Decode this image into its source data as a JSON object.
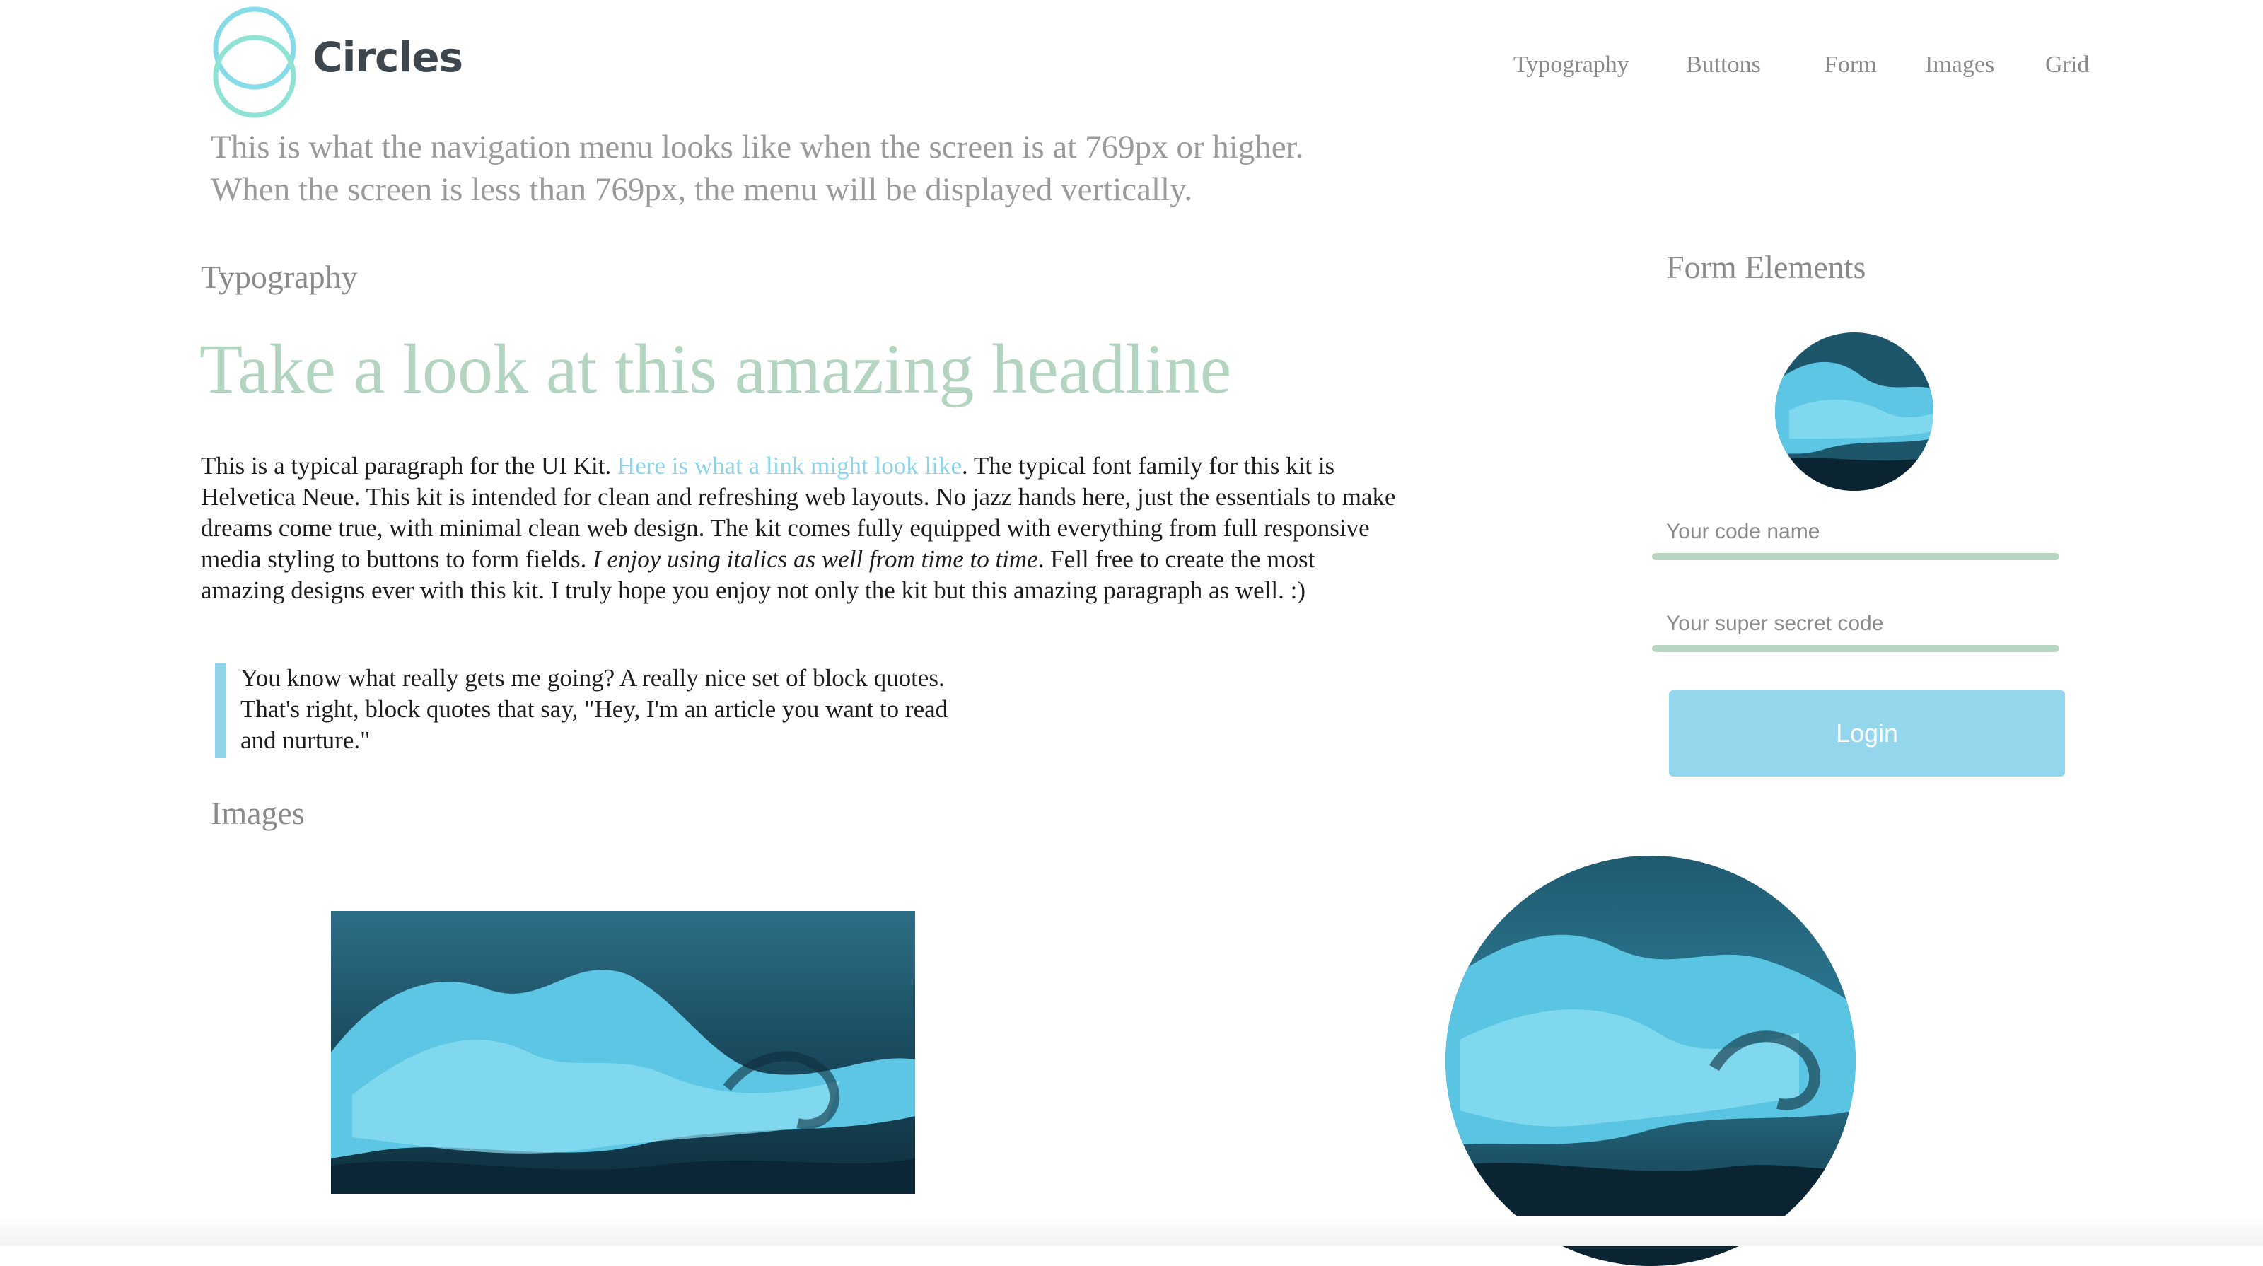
{
  "brand": {
    "name": "Circles",
    "logo_icon": "interlocking-circles-icon",
    "logo_colors": [
      "#7fd8e9",
      "#8ee0d6"
    ]
  },
  "nav": {
    "items": [
      {
        "label": "Typography"
      },
      {
        "label": "Buttons"
      },
      {
        "label": "Form"
      },
      {
        "label": "Images"
      },
      {
        "label": "Grid"
      }
    ],
    "note_line1": "This is what the navigation menu looks like when the screen is at 769px or higher.",
    "note_line2": "When the screen is less than 769px, the menu will be displayed vertically."
  },
  "typography": {
    "section_title": "Typography",
    "headline": "Take a look at this amazing headline",
    "paragraph": {
      "part1": "This is a typical paragraph for the UI Kit. ",
      "link": "Here is what a link might look like",
      "part2": ". The typical font family for this kit is Helvetica Neue. This kit is intended for clean and refreshing web layouts. No jazz hands here, just the essentials to make dreams come true, with minimal clean web design. The kit comes fully equipped with everything from full responsive media styling to buttons to form fields. ",
      "italic": "I enjoy using italics as well from time to time",
      "part3": ". Fell free to create the most amazing designs ever with this kit. I truly hope you enjoy not only the kit but this amazing paragraph as well. :)"
    },
    "blockquote": "You know what really gets me going? A really nice set of block quotes. That's right, block quotes that say, \"Hey, I'm an article you want to read and nurture.\""
  },
  "images": {
    "section_title": "Images"
  },
  "form": {
    "section_title": "Form Elements",
    "codename_placeholder": "Your code name",
    "secret_placeholder": "Your super secret code",
    "login_label": "Login"
  },
  "colors": {
    "headline": "#b3d4c0",
    "link": "#8fd3e8",
    "accent": "#94d7ec",
    "field_underline": "#b8d5c2",
    "wave_dark": "#0f3444",
    "wave_light": "#5bc8e6"
  }
}
